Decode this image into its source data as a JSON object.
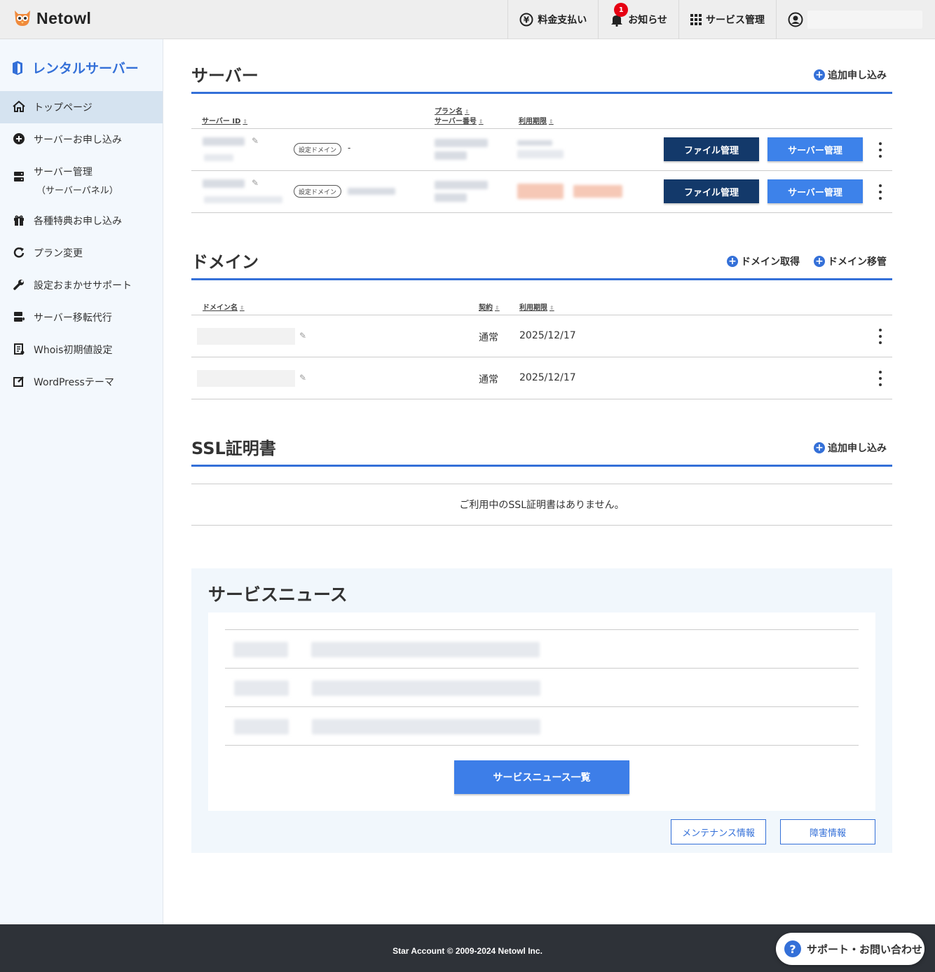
{
  "header": {
    "logo": "Netowl",
    "nav": [
      {
        "label": "料金支払い",
        "icon": "yen-icon"
      },
      {
        "label": "お知らせ",
        "icon": "bell-icon",
        "badge": "1"
      },
      {
        "label": "サービス管理",
        "icon": "grid-icon"
      }
    ]
  },
  "sidebar": {
    "title": "レンタルサーバー",
    "items": [
      {
        "label": "トップページ",
        "icon": "home-icon",
        "active": true
      },
      {
        "label": "サーバーお申し込み",
        "icon": "plus-circle-icon"
      },
      {
        "label": "サーバー管理",
        "sub": "（サーバーパネル）",
        "icon": "server-icon"
      },
      {
        "label": "各種特典お申し込み",
        "icon": "gift-icon"
      },
      {
        "label": "プラン変更",
        "icon": "refresh-icon"
      },
      {
        "label": "設定おまかせサポート",
        "icon": "wrench-icon"
      },
      {
        "label": "サーバー移転代行",
        "icon": "server-move-icon"
      },
      {
        "label": "Whois初期値設定",
        "icon": "document-icon"
      },
      {
        "label": "WordPressテーマ",
        "icon": "edit-icon"
      }
    ]
  },
  "servers": {
    "title": "サーバー",
    "add_label": "追加申し込み",
    "columns": {
      "server_id": "サーバー ID",
      "plan_name": "プラン名",
      "server_number": "サーバー番号",
      "expiry": "利用期限"
    },
    "rows": [
      {
        "tag": "設定ドメイン",
        "domain": "-",
        "file_btn": "ファイル管理",
        "server_btn": "サーバー管理"
      },
      {
        "tag": "設定ドメイン",
        "domain": "",
        "file_btn": "ファイル管理",
        "server_btn": "サーバー管理"
      }
    ]
  },
  "domains": {
    "title": "ドメイン",
    "actions": [
      "ドメイン取得",
      "ドメイン移管"
    ],
    "columns": {
      "name": "ドメイン名",
      "contract": "契約",
      "expiry": "利用期限"
    },
    "rows": [
      {
        "contract": "通常",
        "expiry": "2025/12/17"
      },
      {
        "contract": "通常",
        "expiry": "2025/12/17"
      }
    ]
  },
  "ssl": {
    "title": "SSL証明書",
    "add_label": "追加申し込み",
    "empty": "ご利用中のSSL証明書はありません。"
  },
  "news": {
    "title": "サービスニュース",
    "list_button": "サービスニュース一覧",
    "maintenance": "メンテナンス情報",
    "failure": "障害情報"
  },
  "footer": {
    "copyright": "Star Account © 2009-2024 Netowl Inc.",
    "support": "サポート・お問い合わせ"
  },
  "colors": {
    "accent": "#3470d8",
    "dark_button": "#13396a",
    "footer": "#2e3238",
    "badge": "#e60012"
  }
}
